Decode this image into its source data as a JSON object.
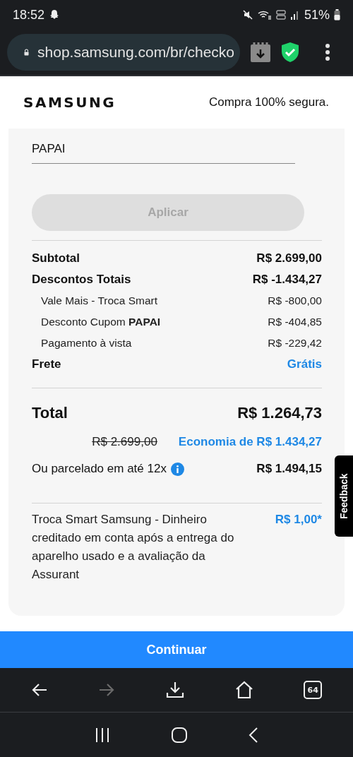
{
  "status_bar": {
    "time": "18:52",
    "battery": "51%"
  },
  "browser": {
    "url": "shop.samsung.com/br/checko",
    "tab_count": "64",
    "forward_disabled": true
  },
  "header": {
    "logo": "SAMSUNG",
    "secure": "Compra 100% segura."
  },
  "coupon": {
    "value": "PAPAI",
    "button": "Aplicar",
    "button_disabled": true
  },
  "summary": [
    {
      "kind": "main",
      "label": "Subtotal",
      "value": "R$ 2.699,00"
    },
    {
      "kind": "main",
      "label": "Descontos Totais",
      "value": "R$ -1.434,27"
    },
    {
      "kind": "sub",
      "label": "Vale Mais - Troca Smart",
      "value": "R$ -800,00"
    },
    {
      "kind": "sub",
      "label": "Desconto Cupom **PAPAI**",
      "value": "R$ -404,85"
    },
    {
      "kind": "sub",
      "label": "Pagamento à vista",
      "value": "R$ -229,42"
    },
    {
      "kind": "free",
      "label": "Frete",
      "value": "Grátis"
    }
  ],
  "total": {
    "label": "Total",
    "value": "R$ 1.264,73",
    "old_price": "R$ 2.699,00",
    "savings": "Economia de R$ 1.434,27"
  },
  "installments": {
    "label": "Ou parcelado em até 12x",
    "value": "R$ 1.494,15"
  },
  "trade_in": {
    "text": "Troca Smart Samsung - Dinheiro creditado em conta após a entrega do aparelho usado e a avaliação da Assurant",
    "value": "R$ 1,00*"
  },
  "continue_button": "Continuar",
  "feedback": "Feedback"
}
